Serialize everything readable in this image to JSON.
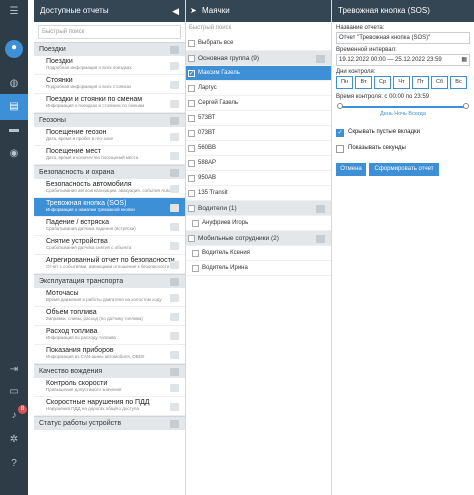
{
  "rail": {
    "items": [
      "menu-icon",
      "user-icon",
      "globe-icon",
      "reports-icon",
      "car-icon",
      "map-pin-icon"
    ],
    "bottom": [
      "logout-icon",
      "chat-icon",
      "bell-icon",
      "settings-icon",
      "help-icon"
    ],
    "badge": "8"
  },
  "reports": {
    "title": "Доступные отчеты",
    "back": "◀",
    "search_placeholder": "Быстрый поиск",
    "sections": [
      {
        "title": "Поездки",
        "items": [
          {
            "t": "Поездки",
            "s": "Подробная информация о всех поездках"
          },
          {
            "t": "Стоянки",
            "s": "Подробная информация о всех стоянках"
          },
          {
            "t": "Поездки и стоянки по сменам",
            "s": "Информация о поездках и стоянках по сменам"
          }
        ]
      },
      {
        "title": "Геозоны",
        "items": [
          {
            "t": "Посещение геозон",
            "s": "Дата, время и пробег в гео-зоне"
          },
          {
            "t": "Посещение мест",
            "s": "Дата, время и количество посещений места"
          }
        ]
      },
      {
        "title": "Безопасность и охрана",
        "items": [
          {
            "t": "Безопасность автомобиля",
            "s": "Срабатывания автосигнализации, эвакуация, события AutoControl, ДТП"
          },
          {
            "t": "Тревожная кнопка (SOS)",
            "s": "Информация о нажатии тревожной кнопки",
            "sel": true
          },
          {
            "t": "Падение / встряска",
            "s": "Срабатывания датчика падения (встряски)"
          },
          {
            "t": "Снятие устройства",
            "s": "Срабатывания датчика снятия с объекта"
          },
          {
            "t": "Агрегированный отчет по безопасности",
            "s": "Отчет с событиями, имеющими отношение к безопасности"
          }
        ]
      },
      {
        "title": "Эксплуатация транспорта",
        "items": [
          {
            "t": "Моточасы",
            "s": "Время движения и работы двигателя на холостом ходу"
          },
          {
            "t": "Объем топлива",
            "s": "Заправки, сливы, расход (по датчику топлива)"
          },
          {
            "t": "Расход топлива",
            "s": "Информация по расходу топлива"
          },
          {
            "t": "Показания приборов",
            "s": "Информация из CAN-шины автомобиля, OBDII"
          }
        ]
      },
      {
        "title": "Качество вождения",
        "items": [
          {
            "t": "Контроль скорости",
            "s": "Превышение допустимого значения"
          },
          {
            "t": "Скоростные нарушения по ПДД",
            "s": "Нарушения ПДД на дорогах общего доступа"
          }
        ]
      },
      {
        "title": "Статус работы устройств",
        "items": []
      }
    ]
  },
  "objects": {
    "title": "Маячки",
    "search_placeholder": "Быстрый поиск",
    "select_all": "Выбрать все",
    "rows": [
      {
        "type": "grp",
        "label": "Основная группа (9)"
      },
      {
        "type": "hl",
        "label": "Максим Газель"
      },
      {
        "type": "it",
        "label": "Ларгус"
      },
      {
        "type": "it",
        "label": "Сергей Газель"
      },
      {
        "type": "it",
        "label": "573ВТ"
      },
      {
        "type": "it",
        "label": "073ВТ"
      },
      {
        "type": "it",
        "label": "560ВВ"
      },
      {
        "type": "it",
        "label": "588АР"
      },
      {
        "type": "it",
        "label": "950АВ"
      },
      {
        "type": "it",
        "label": "135 Transit"
      },
      {
        "type": "grp",
        "label": "Водители (1)"
      },
      {
        "type": "sub",
        "label": "Ануфриев Игорь"
      },
      {
        "type": "grp",
        "label": "Мобильные сотрудники (2)"
      },
      {
        "type": "sub",
        "label": "Водитель Ксения"
      },
      {
        "type": "sub",
        "label": "Водитель Ирина"
      }
    ]
  },
  "settings": {
    "title": "Тревожная кнопка (SOS)",
    "name_label": "Название отчета:",
    "name_value": "Отчет \"Тревожная кнопка (SOS)\"",
    "interval_label": "Временной интервал:",
    "interval_value": "19.12.2022 00:00 — 25.12.2022 23:59",
    "days_label": "Дни контроля:",
    "days": [
      "Пн",
      "Вт",
      "Ср",
      "Чт",
      "Пт",
      "Сб",
      "Вс"
    ],
    "time_label": "Время контроля: с 00:00 по 23:59",
    "time_links": "День  Ночь  Всегда",
    "hide_empty": "Скрывать пустые вкладки",
    "show_seconds": "Показывать секунды",
    "cancel": "Отмена",
    "generate": "Сформировать отчет"
  }
}
